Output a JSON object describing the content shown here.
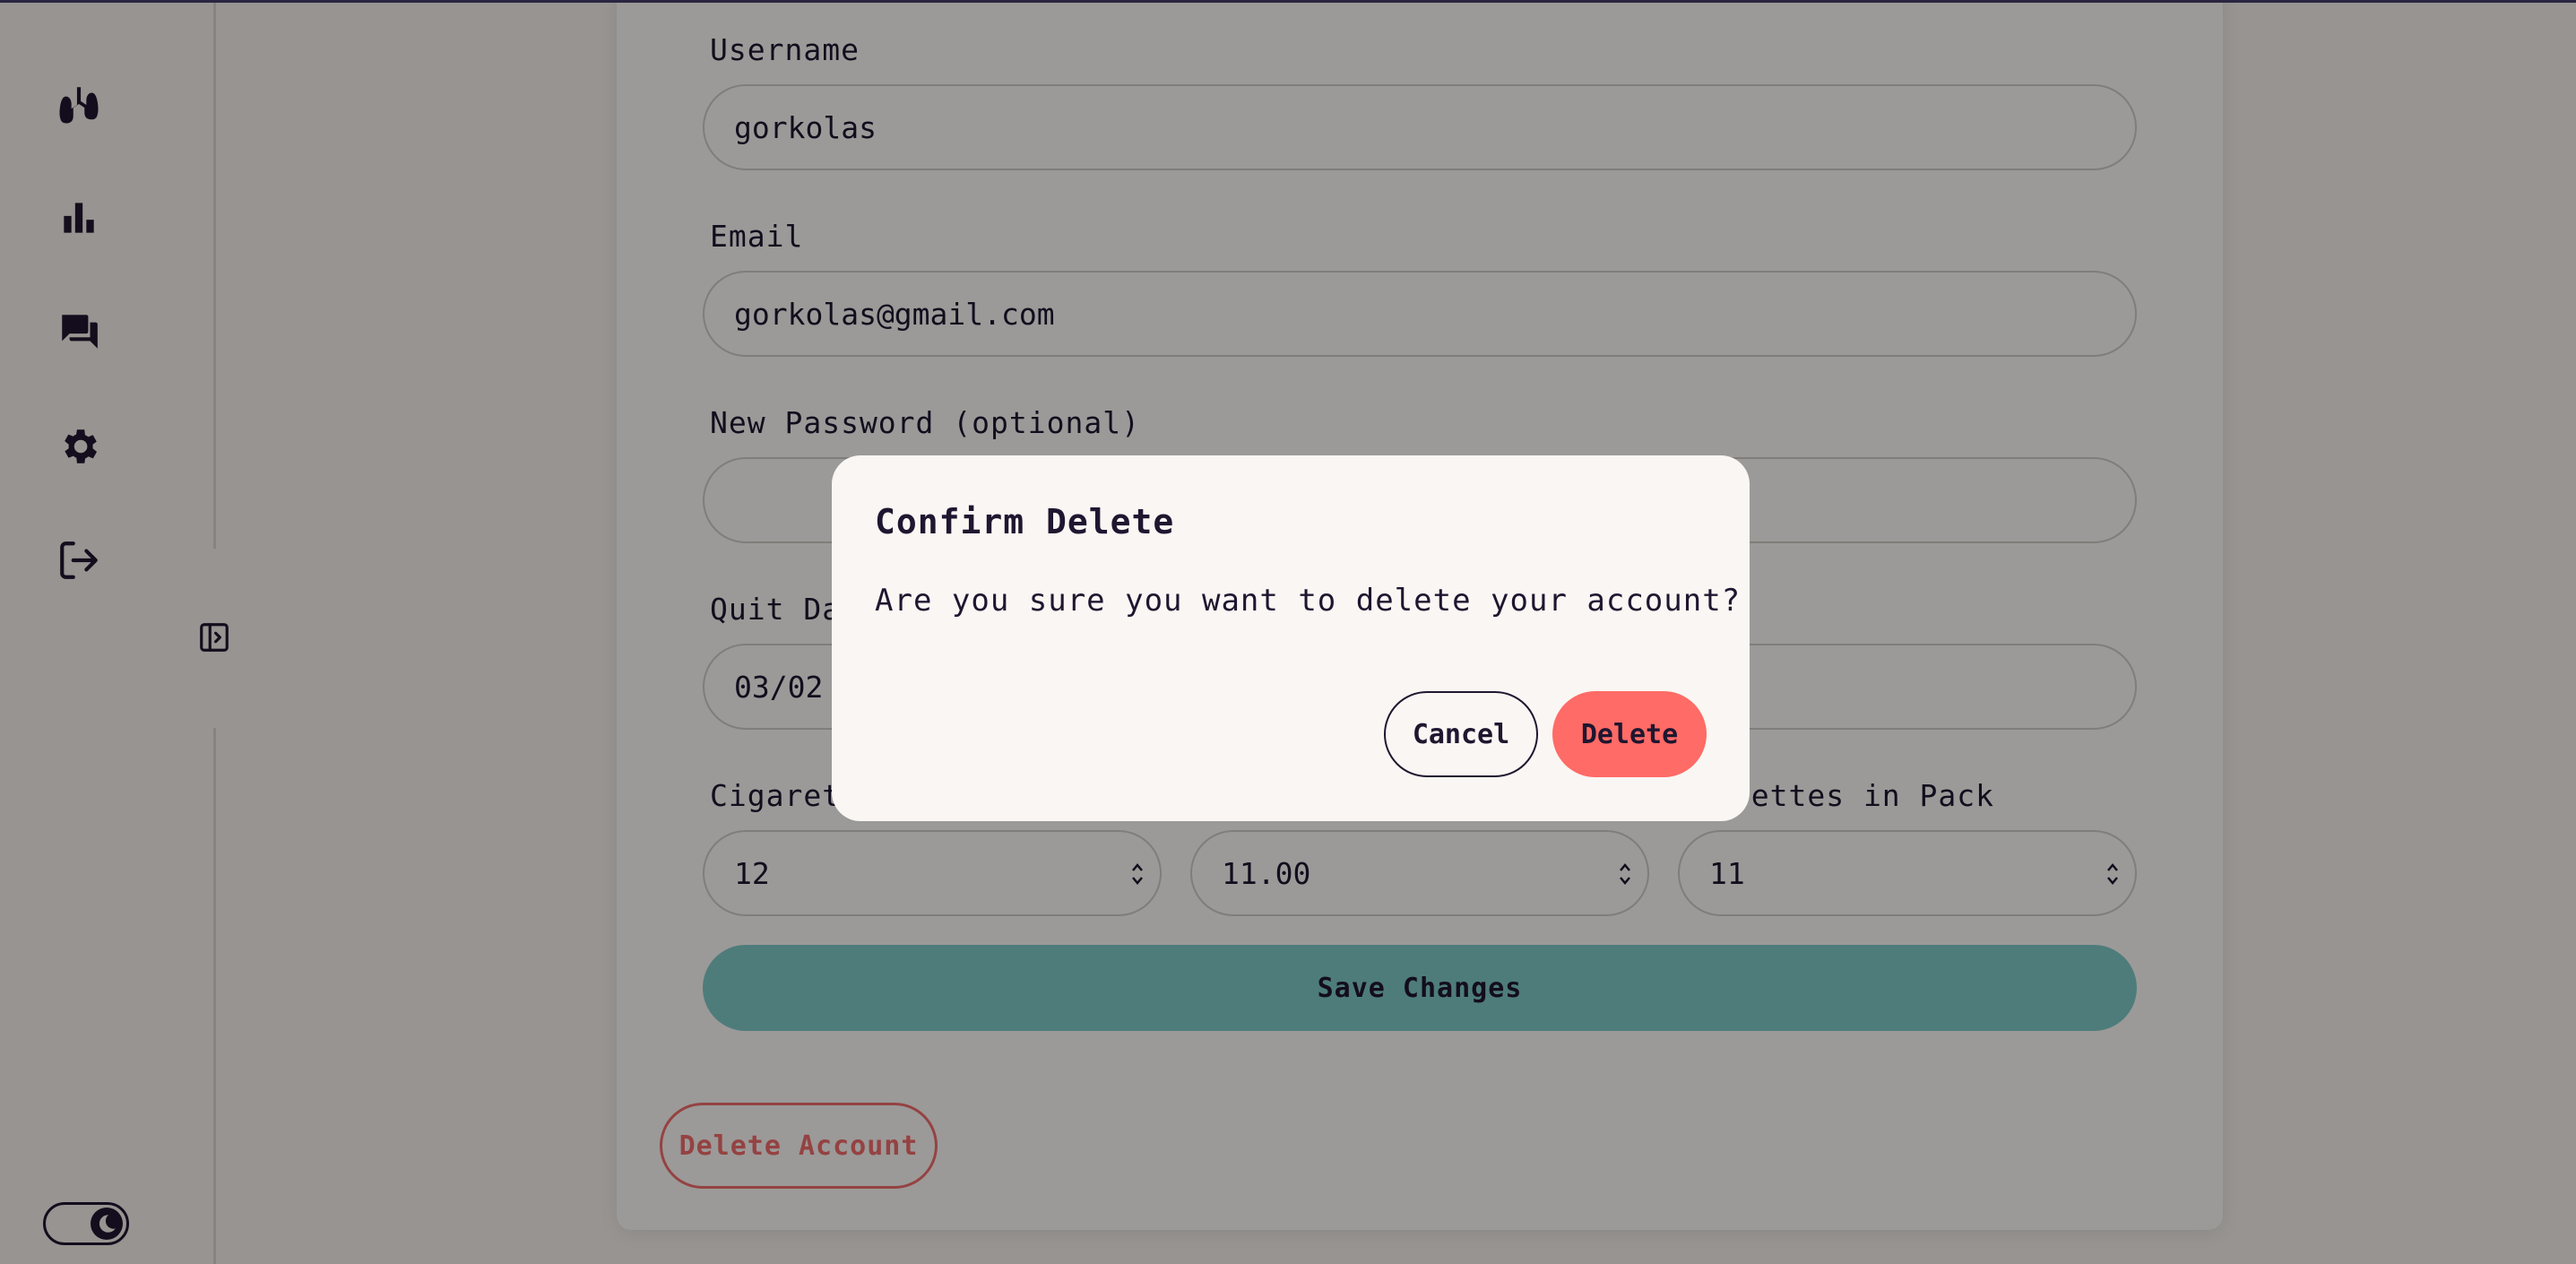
{
  "sidebar": {
    "items": [
      {
        "icon": "lungs-icon"
      },
      {
        "icon": "bar-chart-icon"
      },
      {
        "icon": "chat-icon"
      },
      {
        "icon": "gear-icon"
      },
      {
        "icon": "logout-icon"
      }
    ],
    "collapse_icon": "sidebar-expand-icon",
    "theme_toggle_icon": "moon-icon"
  },
  "form": {
    "username_label": "Username",
    "username_value": "gorkolas",
    "email_label": "Email",
    "email_value": "gorkolas@gmail.com",
    "password_label": "New Password (optional)",
    "password_value": "",
    "quit_date_label": "Quit Da",
    "quit_date_value": "03/02",
    "cigs_label": "Cigaret",
    "cigs_value": "12",
    "price_value": "11.00",
    "pack_label": "urettes in Pack",
    "pack_value": "11",
    "save_label": "Save Changes",
    "delete_account_label": "Delete Account"
  },
  "modal": {
    "title": "Confirm Delete",
    "message": "Are you sure you want to delete your account?",
    "cancel_label": "Cancel",
    "delete_label": "Delete"
  },
  "colors": {
    "accent_teal": "#7fc9c7",
    "danger": "#ff6b66",
    "text": "#1f1630"
  }
}
